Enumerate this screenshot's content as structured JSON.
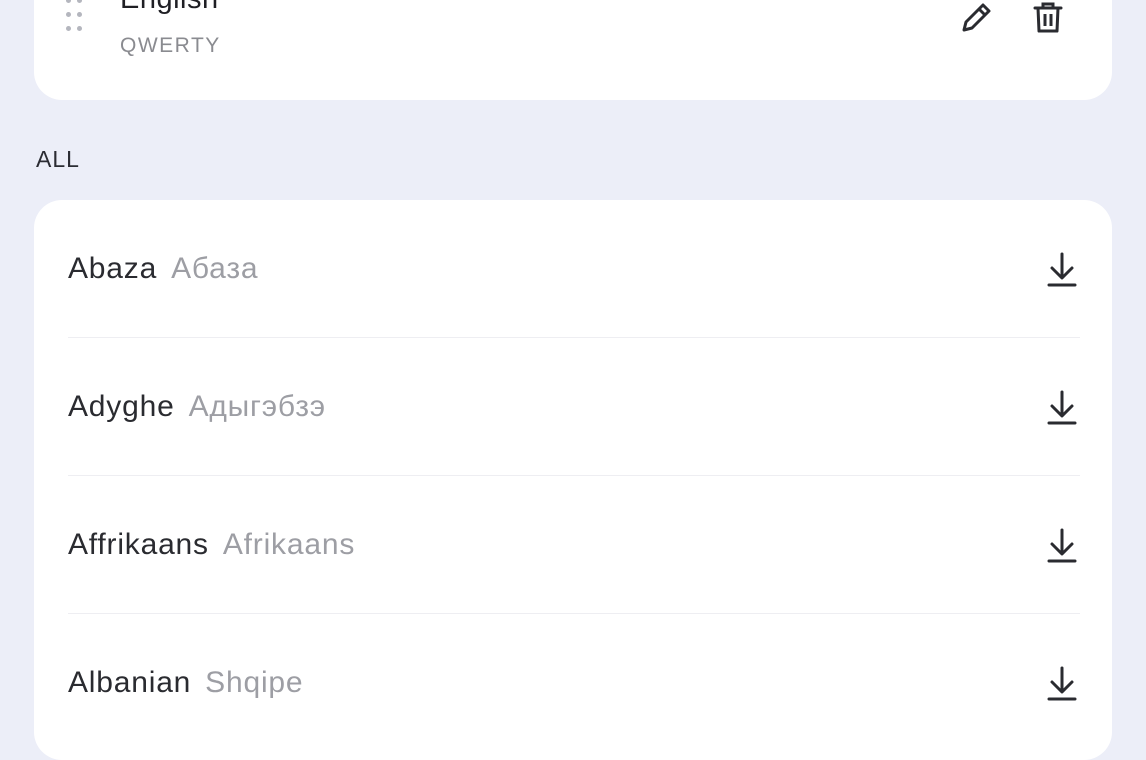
{
  "installed": {
    "name": "English",
    "layout": "QWERTY"
  },
  "section": {
    "all_label": "ALL"
  },
  "languages": [
    {
      "name": "Abaza",
      "native": "Абаза"
    },
    {
      "name": "Adyghe",
      "native": "Адыгэбзэ"
    },
    {
      "name": "Affrikaans",
      "native": "Afrikaans"
    },
    {
      "name": "Albanian",
      "native": "Shqipe"
    }
  ],
  "colors": {
    "background": "#ECEEF8",
    "card": "#FFFFFF",
    "primary_text": "#2A2B30",
    "secondary_text": "#9D9EA4"
  },
  "icons": {
    "drag": "drag-handle-icon",
    "edit": "pencil-icon",
    "delete": "trash-icon",
    "download": "download-icon"
  }
}
